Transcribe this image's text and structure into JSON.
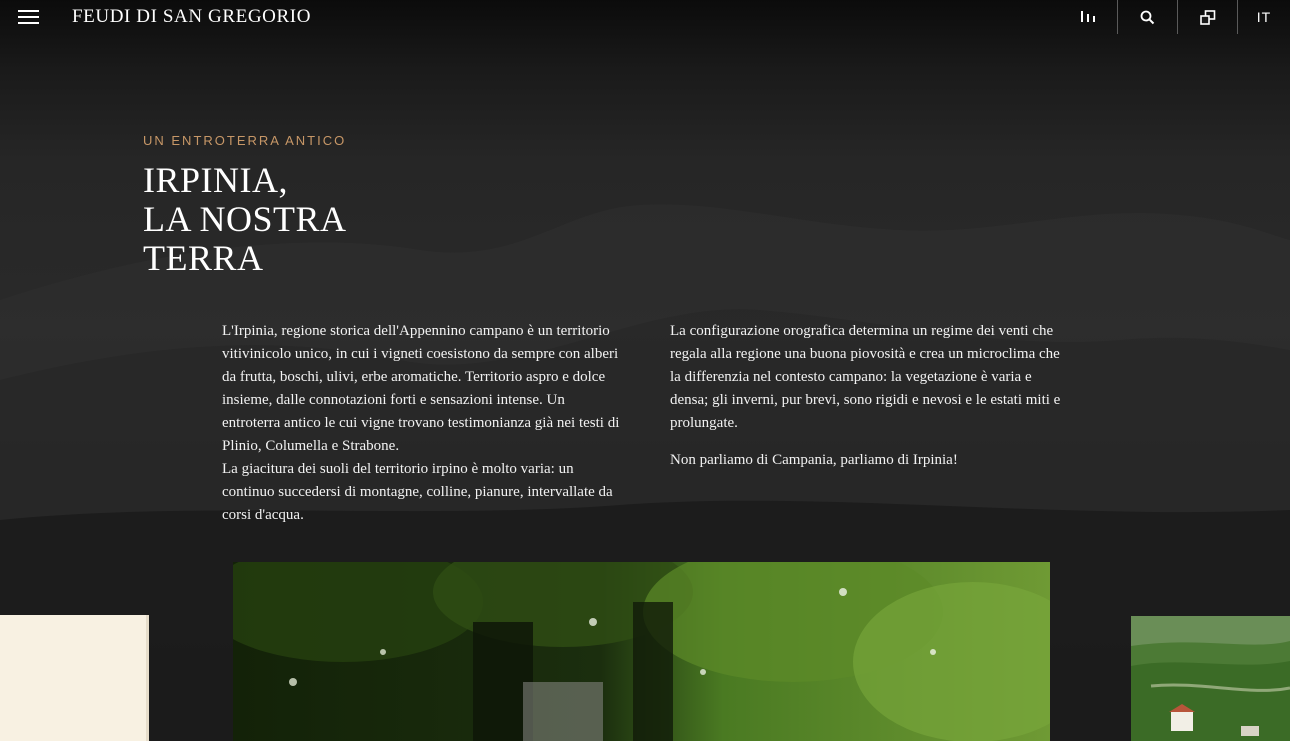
{
  "header": {
    "brand": "FEUDI DI SAN GREGORIO",
    "menu_icon": "hamburger-icon",
    "buttons": [
      {
        "icon": "bar-chart-icon"
      },
      {
        "icon": "search-icon"
      },
      {
        "icon": "overlapping-squares-icon"
      }
    ],
    "language": "IT"
  },
  "hero": {
    "eyebrow": "UN ENTROTERRA ANTICO",
    "title_lines": [
      "IRPINIA,",
      "LA NOSTRA",
      "TERRA"
    ],
    "left_column": [
      "L'Irpinia, regione storica dell'Appennino campano è un territorio vitivinicolo unico, in cui i vigneti coesistono da sempre con alberi da frutta, boschi, ulivi, erbe aromatiche. Territorio aspro e dolce insieme, dalle connotazioni forti e sensazioni intense. Un entroterra antico le cui vigne trovano testimonianza già nei testi di Plinio, Columella e Strabone.",
      "La giacitura dei suoli del territorio irpino è molto varia: un continuo succedersi di montagne, colline, pianure, intervallate da corsi d'acqua."
    ],
    "right_column": [
      "La configurazione orografica determina un regime dei venti che regala alla regione una buona piovosità e crea un microclima che la differenzia nel contesto campano: la vegetazione è varia e densa; gli inverni, pur brevi, sono rigidi e nevosi e le estati miti e prolungate.",
      "Non parliamo di Campania, parliamo di Irpinia!"
    ]
  },
  "colors": {
    "accent": "#c79767",
    "background": "#1d1d1d",
    "text": "#ffffff"
  }
}
